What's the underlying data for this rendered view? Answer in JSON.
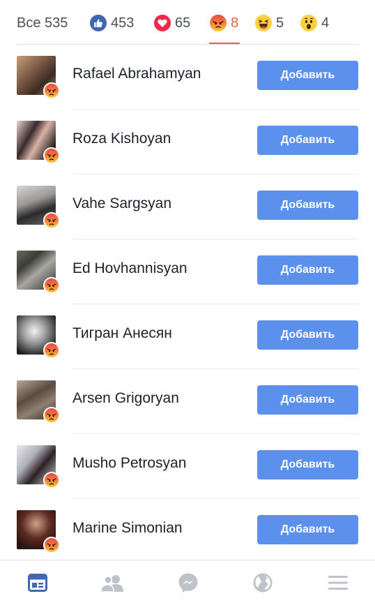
{
  "tabs": {
    "all": {
      "label": "Все",
      "count": "535"
    },
    "like": {
      "count": "453",
      "icon": "like-reaction-icon"
    },
    "love": {
      "count": "65",
      "icon": "love-reaction-icon"
    },
    "angry": {
      "count": "8",
      "icon": "angry-reaction-icon",
      "active": true
    },
    "haha": {
      "count": "5",
      "icon": "haha-reaction-icon"
    },
    "wow": {
      "count": "4",
      "icon": "wow-reaction-icon"
    }
  },
  "people": [
    {
      "name": "Rafael Abrahamyan",
      "button": "Добавить",
      "reaction": "angry"
    },
    {
      "name": "Roza Kishoyan",
      "button": "Добавить",
      "reaction": "angry"
    },
    {
      "name": "Vahe Sargsyan",
      "button": "Добавить",
      "reaction": "angry"
    },
    {
      "name": "Ed Hovhannisyan",
      "button": "Добавить",
      "reaction": "angry"
    },
    {
      "name": "Тигран Анесян",
      "button": "Добавить",
      "reaction": "angry"
    },
    {
      "name": "Arsen Grigoryan",
      "button": "Добавить",
      "reaction": "angry"
    },
    {
      "name": "Musho Petrosyan",
      "button": "Добавить",
      "reaction": "angry"
    },
    {
      "name": "Marine Simonian",
      "button": "Добавить",
      "reaction": "angry"
    }
  ],
  "bottom_nav": [
    {
      "icon": "news-feed-icon",
      "active": true
    },
    {
      "icon": "friends-icon",
      "active": false
    },
    {
      "icon": "messenger-icon",
      "active": false
    },
    {
      "icon": "globe-icon",
      "active": false
    },
    {
      "icon": "menu-icon",
      "active": false
    }
  ],
  "colors": {
    "accent": "#5b90ec",
    "angry": "#f05d3b",
    "nav_active": "#4267b2",
    "nav_inactive": "#bec2c9"
  }
}
